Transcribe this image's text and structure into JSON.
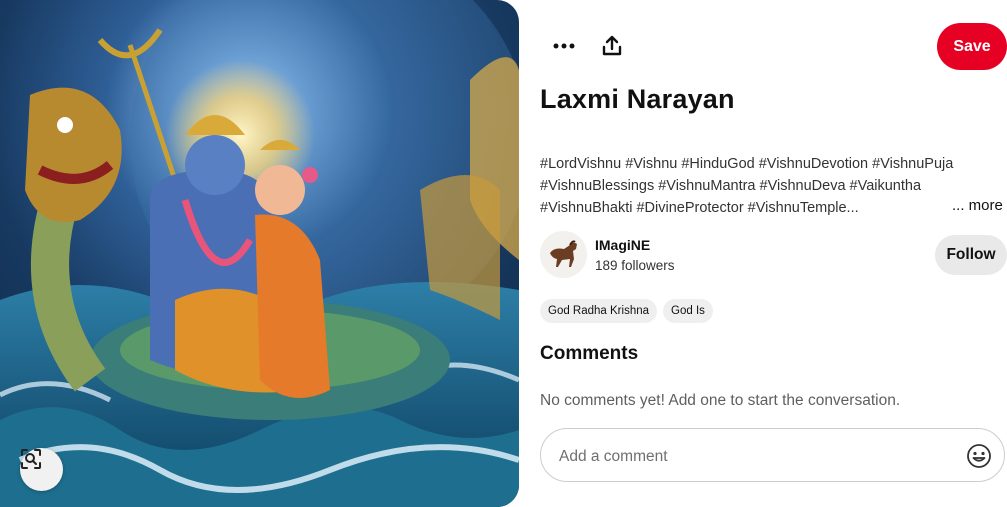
{
  "pin": {
    "image_alt": "Laxmi Narayan artwork",
    "lens_icon": "visual-search-icon"
  },
  "toolbar": {
    "more_icon": "ellipsis-icon",
    "share_icon": "share-icon",
    "save_label": "Save"
  },
  "title": "Laxmi Narayan",
  "description": {
    "lines": [
      "#LordVishnu #Vishnu #HinduGod #VishnuDevotion #VishnuPuja",
      "#VishnuBlessings #VishnuMantra #VishnuDeva #Vaikuntha",
      "#VishnuBhakti #DivineProtector #VishnuTemple..."
    ],
    "more_label": "... more"
  },
  "creator": {
    "name": "IMagiNE",
    "followers": "189 followers",
    "follow_label": "Follow"
  },
  "tags": [
    "God Radha Krishna",
    "God Is"
  ],
  "comments": {
    "heading": "Comments",
    "empty_text": "No comments yet! Add one to start the conversation.",
    "placeholder": "Add a comment",
    "emoji_icon": "emoji-icon"
  },
  "colors": {
    "save_red": "#e60023",
    "button_gray": "#e9e9e9"
  }
}
